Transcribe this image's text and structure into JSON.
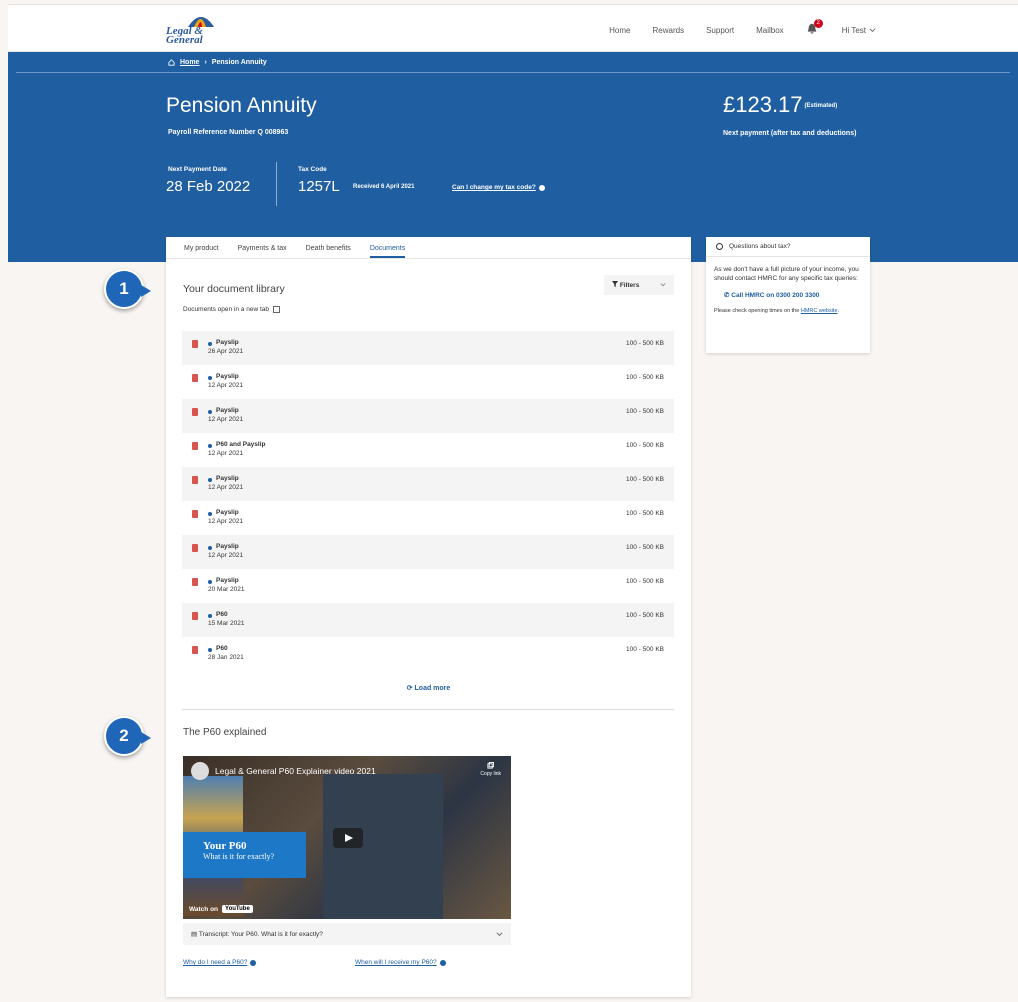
{
  "nav": {
    "home": "Home",
    "rewards": "Rewards",
    "support": "Support",
    "mailbox": "Mailbox",
    "badge_count": "2",
    "user": "Hi Test"
  },
  "breadcrumb": {
    "home": "Home",
    "current": "Pension Annuity"
  },
  "hero": {
    "title": "Pension Annuity",
    "payroll_ref": "Payroll Reference Number Q 008963",
    "amount": "£123.17",
    "amount_note": "(Estimated)",
    "next_payment_note": "Next payment (after tax and deductions)",
    "next_payment_label": "Next Payment Date",
    "next_payment_value": "28 Feb 2022",
    "tax_code_label": "Tax Code",
    "tax_code_value": "1257L",
    "tax_received": "Received 6 April 2021",
    "tax_link": "Can I change my tax code?"
  },
  "tabs": [
    "My product",
    "Payments & tax",
    "Death benefits",
    "Documents"
  ],
  "library": {
    "title": "Your document library",
    "filters": "Filters",
    "opens_note": "Documents open in a new tab",
    "load_more": "Load more",
    "docs": [
      {
        "name": "Payslip",
        "date": "26 Apr 2021",
        "size": "100 - 500 KB"
      },
      {
        "name": "Payslip",
        "date": "12 Apr 2021",
        "size": "100 - 500 KB"
      },
      {
        "name": "Payslip",
        "date": "12 Apr 2021",
        "size": "100 - 500 KB"
      },
      {
        "name": "P60 and Payslip",
        "date": "12 Apr 2021",
        "size": "100 - 500 KB"
      },
      {
        "name": "Payslip",
        "date": "12 Apr 2021",
        "size": "100 - 500 KB"
      },
      {
        "name": "Payslip",
        "date": "12 Apr 2021",
        "size": "100 - 500 KB"
      },
      {
        "name": "Payslip",
        "date": "12 Apr 2021",
        "size": "100 - 500 KB"
      },
      {
        "name": "Payslip",
        "date": "20 Mar 2021",
        "size": "100 - 500 KB"
      },
      {
        "name": "P60",
        "date": "15 Mar 2021",
        "size": "100 - 500 KB"
      },
      {
        "name": "P60",
        "date": "28 Jan 2021",
        "size": "100 - 500 KB"
      }
    ]
  },
  "p60": {
    "title": "The P60 explained",
    "video_title": "Legal & General P60 Explainer video 2021",
    "copy_link": "Copy link",
    "overlay_l1": "Your P60",
    "overlay_l2": "What is it for exactly?",
    "watch_on": "Watch on",
    "youtube": "YouTube",
    "transcript": "Transcript: Your P60. What is it for exactly?",
    "link_why": "Why do I need a P60?",
    "link_when": "When will I receive my P60?"
  },
  "sidebar": {
    "title": "Questions about tax?",
    "body": "As we don't have a full picture of your income, you should contact HMRC for any specific tax queries:",
    "call": "Call HMRC on 0300 200 3300",
    "note": "Please check opening times on the",
    "note_link": "HMRC website"
  },
  "callouts": [
    "1",
    "2"
  ],
  "colors": {
    "brand_blue": "#1f5ea0",
    "callout_blue": "#1f66b8",
    "bg": "#f8f5f2"
  }
}
